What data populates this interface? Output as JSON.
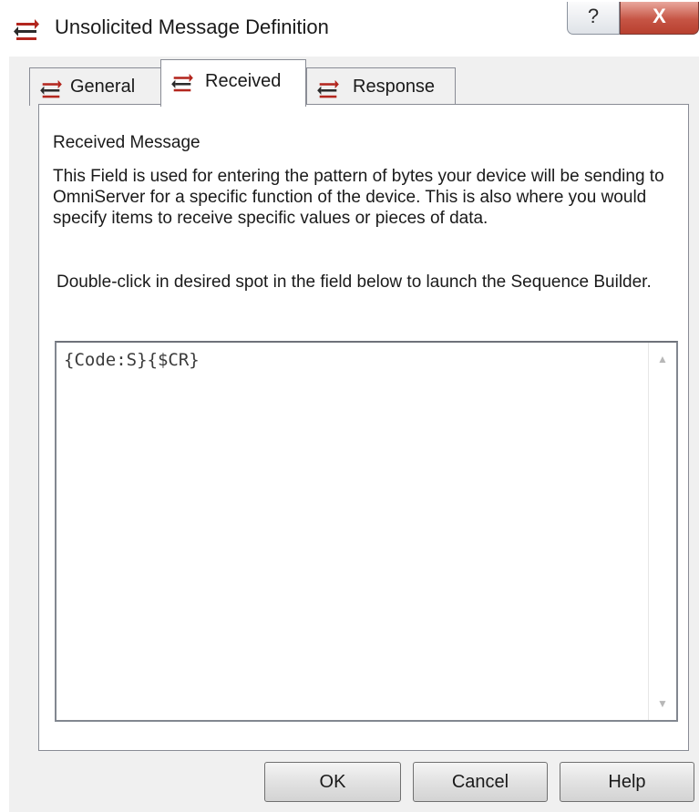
{
  "window": {
    "title": "Unsolicited Message Definition",
    "title_icon": "message-arrows-icon",
    "help_caption_glyph": "?",
    "close_caption_glyph": "X"
  },
  "tabs": [
    {
      "label": "General",
      "icon": "message-arrows-icon",
      "selected": false
    },
    {
      "label": "Received",
      "icon": "message-arrows-icon",
      "selected": true
    },
    {
      "label": "Response",
      "icon": "message-arrows-icon",
      "selected": false
    }
  ],
  "received": {
    "section_label": "Received Message",
    "description": "This Field is used for entering the pattern of bytes your device will be sending to OmniServer for a specific function of the device.  This is also where you would specify items to receive specific values or pieces of data.",
    "hint": "Double-click in desired spot in the field below to launch the Sequence Builder.",
    "message_value": "{Code:S}{$CR}"
  },
  "buttons": {
    "ok": "OK",
    "cancel": "Cancel",
    "help": "Help"
  },
  "colors": {
    "icon_red": "#b3261e",
    "icon_dark": "#2b2b2b",
    "close_button": "#c65545",
    "dialog_background": "#f0f0f0"
  }
}
